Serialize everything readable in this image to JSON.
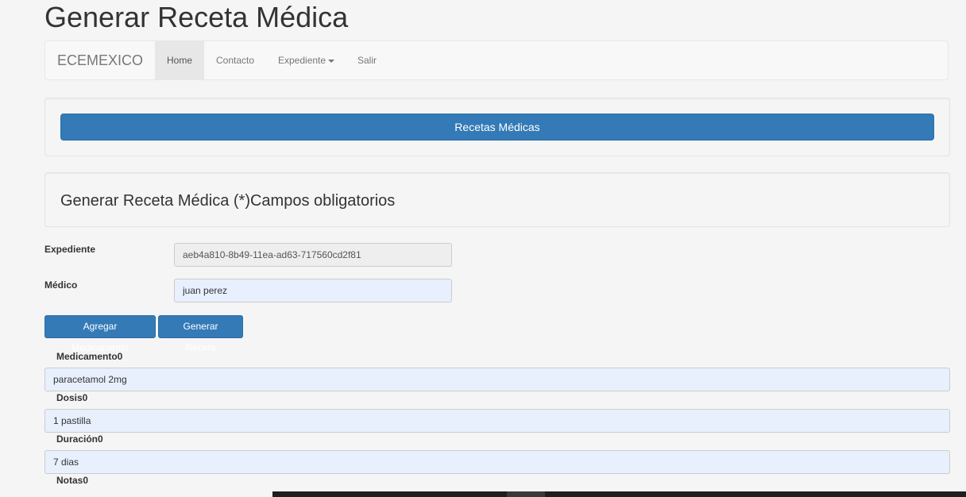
{
  "page": {
    "title": "Generar Receta Médica"
  },
  "navbar": {
    "brand": "ECEMEXICO",
    "items": [
      {
        "label": "Home",
        "active": true
      },
      {
        "label": "Contacto",
        "active": false
      },
      {
        "label": "Expediente",
        "active": false,
        "dropdown": true
      },
      {
        "label": "Salir",
        "active": false
      }
    ]
  },
  "recetas_button": "Recetas Médicas",
  "form": {
    "heading": "Generar Receta Médica (*)Campos obligatorios",
    "expediente_label": "Expediente",
    "expediente_value": "aeb4a810-8b49-11ea-ad63-717560cd2f81",
    "medico_label": "Médico",
    "medico_value": "juan perez",
    "add_med_button": "Agregar Medicamento",
    "generate_button": "Generar Receta",
    "medicamento_label": "Medicamento0",
    "medicamento_value": "paracetamol 2mg",
    "dosis_label": "Dosis0",
    "dosis_value": "1 pastilla",
    "duracion_label": "Duración0",
    "duracion_value": "7 dias",
    "notas_label": "Notas0"
  },
  "colors": {
    "primary": "#337ab7",
    "autofill": "#e8f0fe",
    "background": "#f5f5f5"
  }
}
